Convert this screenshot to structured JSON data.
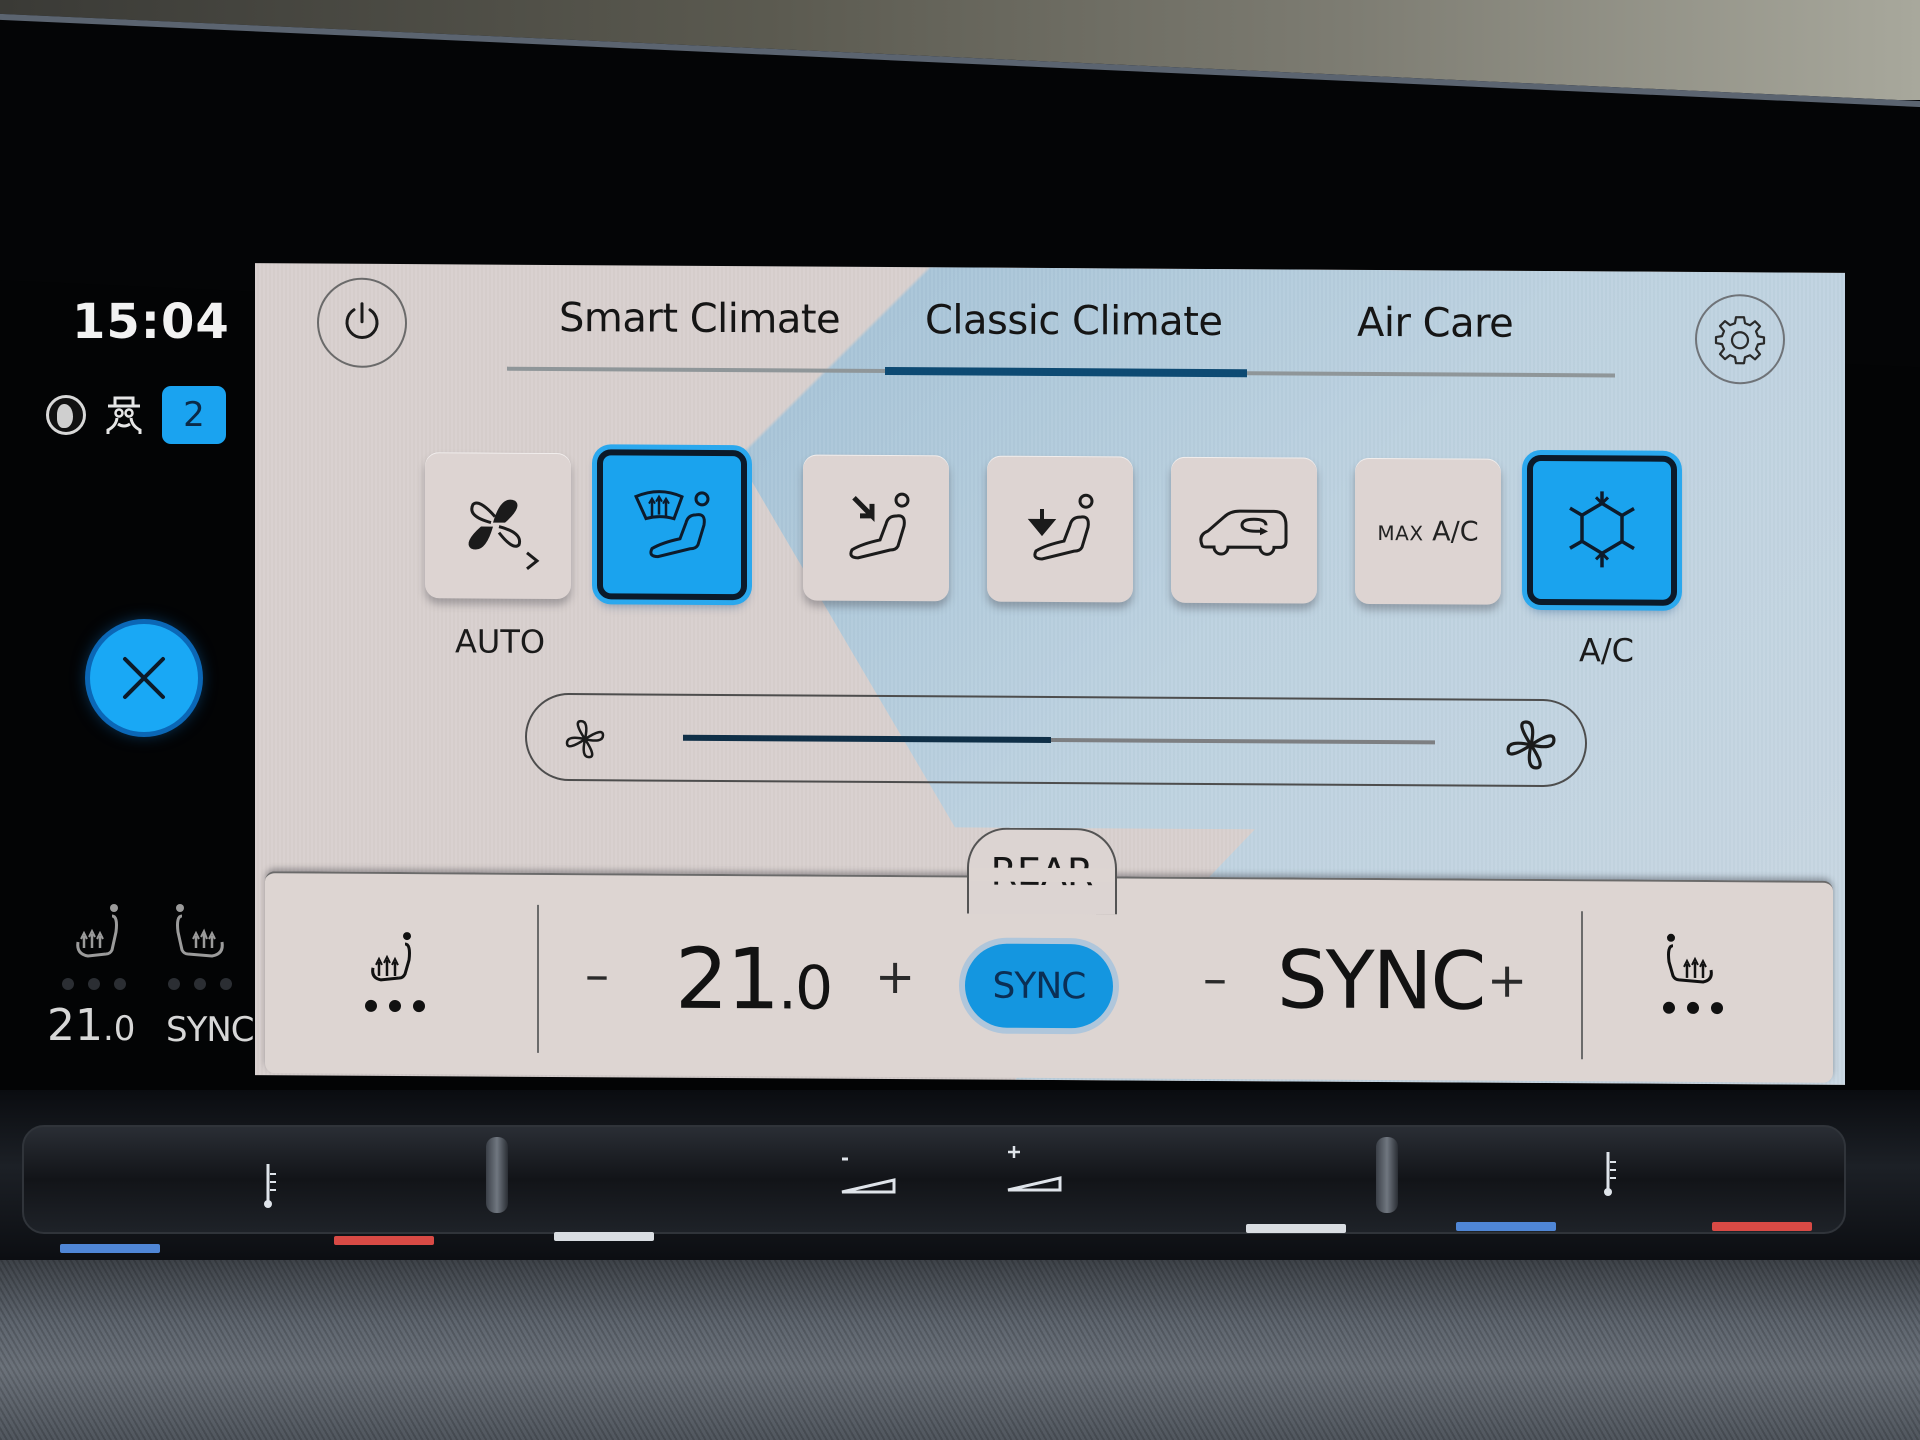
{
  "status_column": {
    "time": "15:04",
    "icons": [
      "globe-icon",
      "privacy-spy-icon"
    ],
    "profile_number": "2",
    "close_icon": "close-icon",
    "mini_climate": {
      "driver_seat_icon": "seat-heating-driver-icon",
      "passenger_seat_icon": "seat-heating-passenger-icon",
      "driver_temp_main": "21",
      "driver_temp_decimal": ".0",
      "passenger_temp": "SYNC",
      "driver_seat_heat_level": 0,
      "passenger_seat_heat_level": 0
    }
  },
  "header": {
    "power_icon": "power-icon",
    "settings_icon": "gear-icon",
    "tabs": [
      {
        "label": "Smart Climate",
        "active": false
      },
      {
        "label": "Classic Climate",
        "active": true
      },
      {
        "label": "Air Care",
        "active": false
      }
    ]
  },
  "modes": [
    {
      "id": "auto",
      "icon": "fan-auto-icon",
      "label": "AUTO",
      "active": false
    },
    {
      "id": "defrost",
      "icon": "windshield-defrost-person-icon",
      "label": "",
      "active": true
    },
    {
      "id": "airflow-upper",
      "icon": "airflow-upper-body-icon",
      "label": "",
      "active": false
    },
    {
      "id": "airflow-footwell",
      "icon": "airflow-footwell-icon",
      "label": "",
      "active": false
    },
    {
      "id": "recirculation",
      "icon": "air-recirculation-car-icon",
      "label": "",
      "active": false
    },
    {
      "id": "max-ac",
      "icon": "",
      "label_small": "MAX",
      "label": "A/C",
      "active": false
    },
    {
      "id": "ac",
      "icon": "snowflake-icon",
      "label": "A/C",
      "active": true
    }
  ],
  "fan": {
    "min_icon": "fan-low-icon",
    "max_icon": "fan-high-icon",
    "level_fraction": 0.49
  },
  "rear_tab": {
    "label": "REAR"
  },
  "bottom": {
    "left_seat_icon": "seat-heating-driver-icon",
    "left_seat_level": 3,
    "minus": "–",
    "plus": "+",
    "driver_temp_main": "21",
    "driver_temp_decimal": ".0",
    "sync_button": "SYNC",
    "sync_active": true,
    "passenger_temp": "SYNC",
    "right_seat_icon": "seat-heating-passenger-icon",
    "right_seat_level": 3
  },
  "physical_controls": {
    "glyphs": [
      "temp-left",
      "volume-minus",
      "volume-plus",
      "temp-right"
    ],
    "minus": "-",
    "plus": "+",
    "strip_colors": [
      "#4f86d6",
      "#d84a45",
      "#d9dde2",
      "#d9dde2",
      "#4f86d6",
      "#d84a45"
    ]
  },
  "colors": {
    "accent_blue": "#1aa3ee",
    "tab_indicator": "#0d4a73",
    "screen_bg": "#d8d0ce",
    "screen_blue": "#b8cfdf"
  }
}
